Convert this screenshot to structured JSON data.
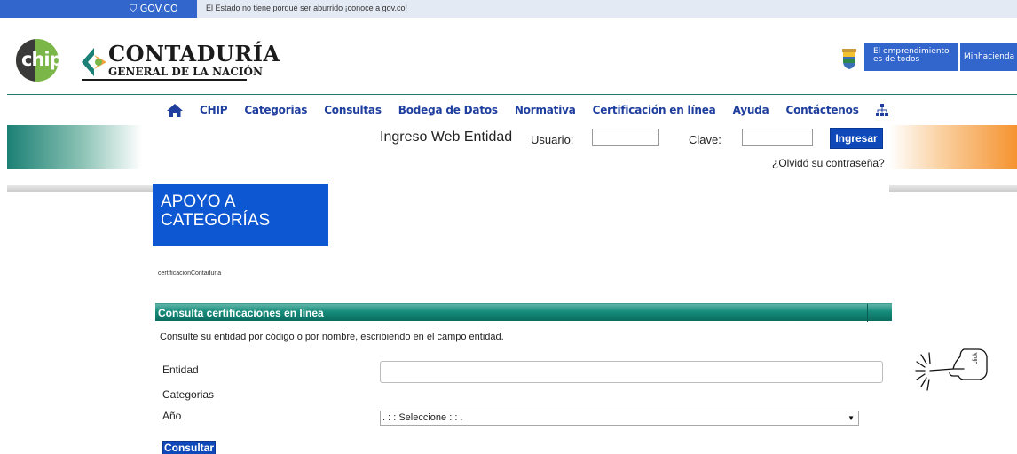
{
  "gov_bar": {
    "logo": "GOV.CO",
    "message": "El Estado no tiene porqué ser aburrido ¡conoce a gov.co!"
  },
  "header": {
    "chip_logo": "chip",
    "entity_name_line1": "CONTADURÍA",
    "entity_name_line2": "GENERAL DE LA NACIÓN",
    "slogan": "El emprendimiento es de todos",
    "ministry": "Minhacienda"
  },
  "nav": {
    "items": [
      "CHIP",
      "Categorias",
      "Consultas",
      "Bodega de Datos",
      "Normativa",
      "Certificación en línea",
      "Ayuda",
      "Contáctenos"
    ]
  },
  "login": {
    "title": "Ingreso Web Entidad",
    "user_label": "Usuario:",
    "user_value": "",
    "password_label": "Clave:",
    "password_value": "",
    "submit_label": "Ingresar",
    "forgot_link": "¿Olvidó su contraseña?"
  },
  "section": {
    "title": "APOYO A CATEGORÍAS",
    "breadcrumb": "certificacionContaduria"
  },
  "consulta": {
    "panel_title": "Consulta certificaciones en línea",
    "instructions": "Consulte su entidad por código o por nombre, escribiendo en el campo entidad.",
    "entidad_label": "Entidad",
    "entidad_value": "",
    "categorias_label": "Categorias",
    "ano_label": "Año",
    "ano_selected": ". : : Seleccione : : .",
    "submit_label": "Consultar"
  },
  "click_icon_text": "click",
  "colors": {
    "gov_blue": "#3366cc",
    "nav_blue": "#1f3e9e",
    "button_blue": "#0f48b8",
    "panel_teal": "#168c7b",
    "section_blue": "#0d57d2"
  }
}
